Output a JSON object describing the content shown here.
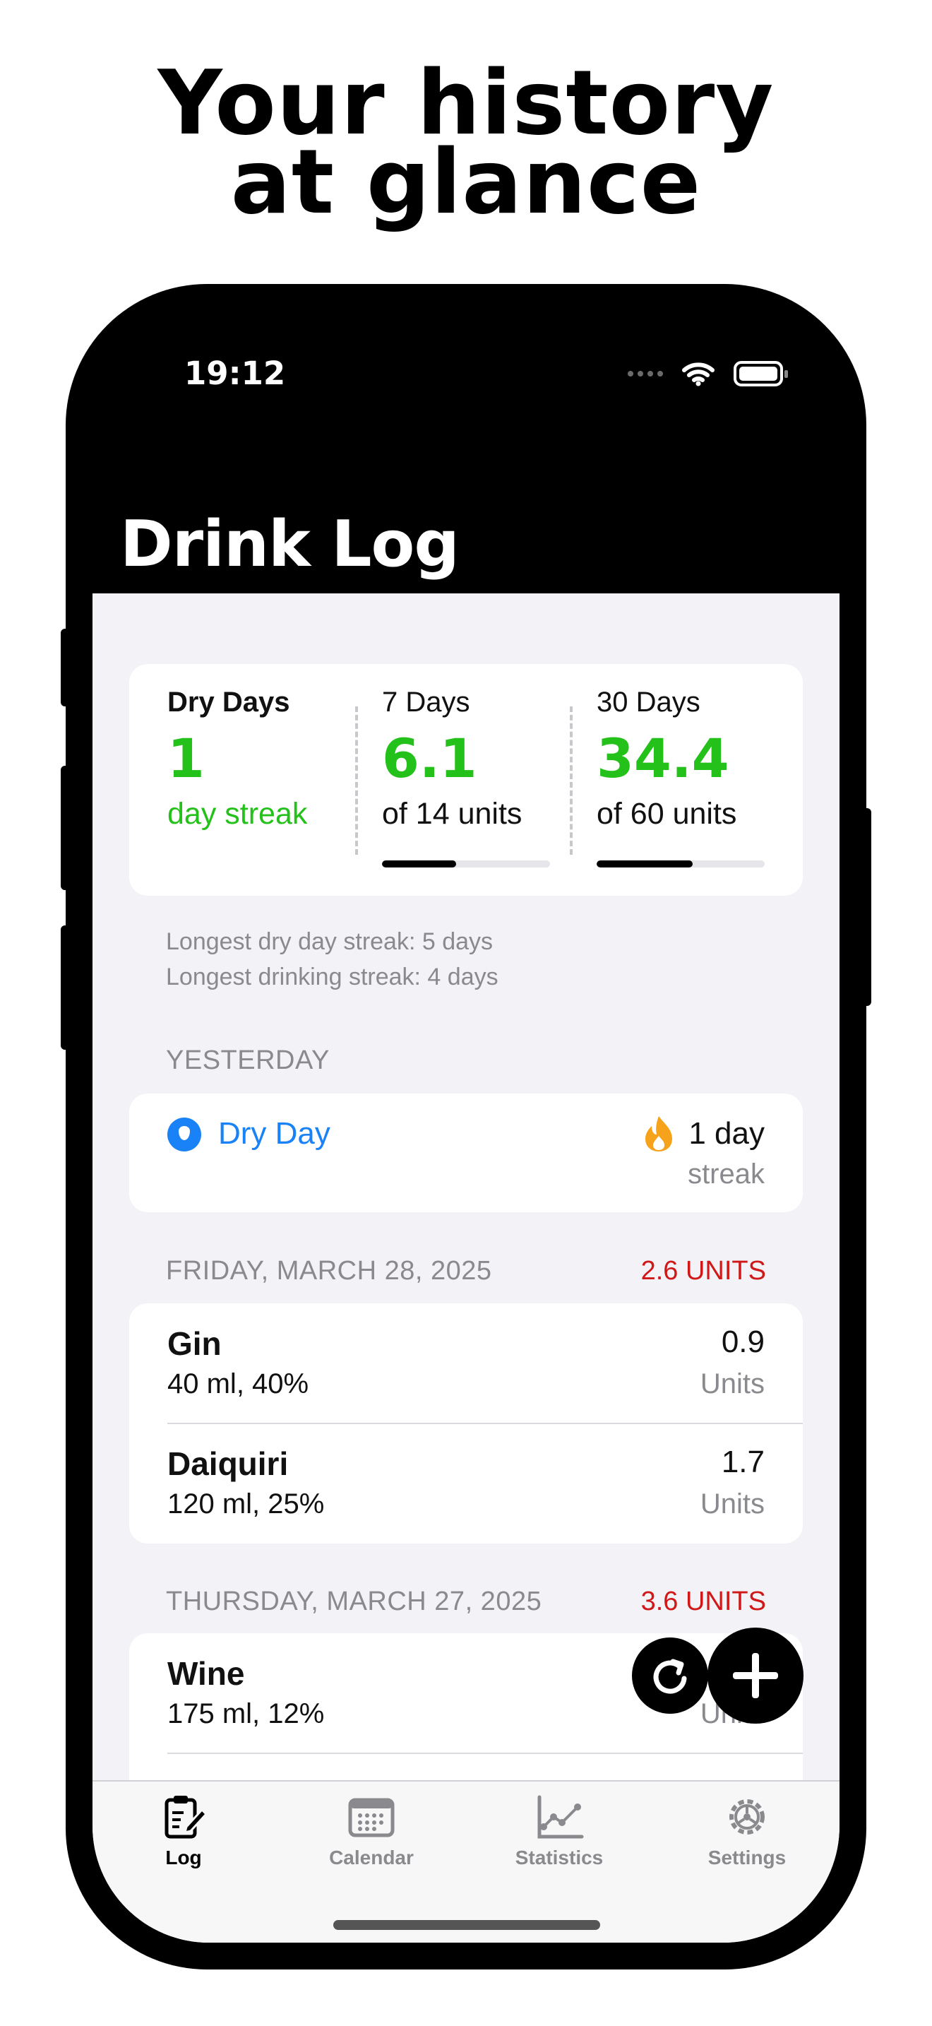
{
  "headline": {
    "line1": "Your history",
    "line2": "at glance"
  },
  "status_bar": {
    "time": "19:12"
  },
  "nav": {
    "title": "Drink Log"
  },
  "summary": {
    "dry_days": {
      "label": "Dry Days",
      "value": "1",
      "sub": "day streak"
    },
    "seven_days": {
      "label": "7 Days",
      "value": "6.1",
      "sub": "of 14 units",
      "progress": 0.44
    },
    "thirty_days": {
      "label": "30 Days",
      "value": "34.4",
      "sub": "of 60 units",
      "progress": 0.57
    }
  },
  "notes": {
    "longest_dry": "Longest dry day streak: 5 days",
    "longest_drinking": "Longest drinking streak: 4 days"
  },
  "sections": [
    {
      "header": "YESTERDAY",
      "dry_day": {
        "label": "Dry Day",
        "streak": "1 day",
        "streak_word": "streak"
      }
    },
    {
      "header": "FRIDAY, MARCH 28, 2025",
      "units": "2.6 UNITS",
      "drinks": [
        {
          "name": "Gin",
          "detail": "40 ml, 40%",
          "value": "0.9",
          "unit": "Units"
        },
        {
          "name": "Daiquiri",
          "detail": "120 ml, 25%",
          "value": "1.7",
          "unit": "Units"
        }
      ]
    },
    {
      "header": "THURSDAY, MARCH 27, 2025",
      "units": "3.6 UNITS",
      "drinks": [
        {
          "name": "Wine",
          "detail": "175 ml, 12%",
          "value": "",
          "unit": "Units"
        }
      ]
    }
  ],
  "tabs": [
    {
      "label": "Log",
      "icon": "log-icon",
      "active": true
    },
    {
      "label": "Calendar",
      "icon": "calendar-icon",
      "active": false
    },
    {
      "label": "Statistics",
      "icon": "statistics-icon",
      "active": false
    },
    {
      "label": "Settings",
      "icon": "settings-icon",
      "active": false
    }
  ],
  "colors": {
    "accent_green": "#25c11b",
    "accent_blue": "#1a82f7",
    "units_red": "#d01818",
    "flame_orange": "#f6a21a"
  }
}
